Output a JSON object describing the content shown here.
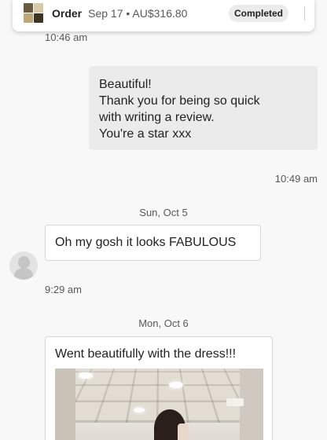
{
  "order": {
    "label": "Order",
    "meta": "Sep 17 • AU$316.80",
    "status": "Completed"
  },
  "messages": {
    "ts_top": "10:46 am",
    "outgoing_lines": [
      "Beautiful!",
      "Thank you for being so quick",
      "with writing a review.",
      "You're a star xxx"
    ],
    "ts_outgoing": "10:49 am",
    "day1": "Sun, Oct 5",
    "incoming1": "Oh my gosh it looks FABULOUS",
    "ts_incoming1": "9:29 am",
    "day2": "Mon, Oct 6",
    "incoming2": "Went beautifully with the dress!!!"
  },
  "icons": {
    "avatar": "user-avatar-icon",
    "photo": "attached-photo"
  },
  "colors": {
    "outgoing_bubble": "#ebebeb",
    "incoming_bubble": "#ffffff",
    "badge": "#ebebeb"
  }
}
